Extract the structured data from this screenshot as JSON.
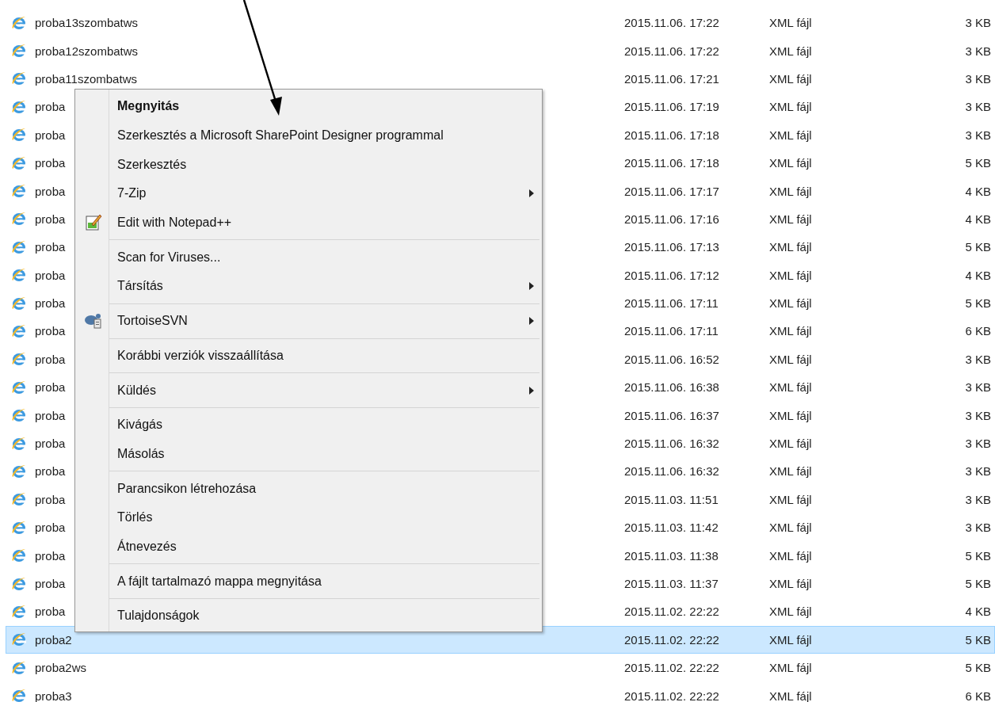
{
  "files": [
    {
      "name": "proba13szombatws",
      "date": "2015.11.06. 17:22",
      "type": "XML fájl",
      "size": "3 KB",
      "selected": false
    },
    {
      "name": "proba12szombatws",
      "date": "2015.11.06. 17:22",
      "type": "XML fájl",
      "size": "3 KB",
      "selected": false
    },
    {
      "name": "proba11szombatws",
      "date": "2015.11.06. 17:21",
      "type": "XML fájl",
      "size": "3 KB",
      "selected": false
    },
    {
      "name": "proba",
      "date": "2015.11.06. 17:19",
      "type": "XML fájl",
      "size": "3 KB",
      "selected": false
    },
    {
      "name": "proba",
      "date": "2015.11.06. 17:18",
      "type": "XML fájl",
      "size": "3 KB",
      "selected": false
    },
    {
      "name": "proba",
      "date": "2015.11.06. 17:18",
      "type": "XML fájl",
      "size": "5 KB",
      "selected": false
    },
    {
      "name": "proba",
      "date": "2015.11.06. 17:17",
      "type": "XML fájl",
      "size": "4 KB",
      "selected": false
    },
    {
      "name": "proba",
      "date": "2015.11.06. 17:16",
      "type": "XML fájl",
      "size": "4 KB",
      "selected": false
    },
    {
      "name": "proba",
      "date": "2015.11.06. 17:13",
      "type": "XML fájl",
      "size": "5 KB",
      "selected": false
    },
    {
      "name": "proba",
      "date": "2015.11.06. 17:12",
      "type": "XML fájl",
      "size": "4 KB",
      "selected": false
    },
    {
      "name": "proba",
      "date": "2015.11.06. 17:11",
      "type": "XML fájl",
      "size": "5 KB",
      "selected": false
    },
    {
      "name": "proba",
      "date": "2015.11.06. 17:11",
      "type": "XML fájl",
      "size": "6 KB",
      "selected": false
    },
    {
      "name": "proba",
      "date": "2015.11.06. 16:52",
      "type": "XML fájl",
      "size": "3 KB",
      "selected": false
    },
    {
      "name": "proba",
      "date": "2015.11.06. 16:38",
      "type": "XML fájl",
      "size": "3 KB",
      "selected": false
    },
    {
      "name": "proba",
      "date": "2015.11.06. 16:37",
      "type": "XML fájl",
      "size": "3 KB",
      "selected": false
    },
    {
      "name": "proba",
      "date": "2015.11.06. 16:32",
      "type": "XML fájl",
      "size": "3 KB",
      "selected": false
    },
    {
      "name": "proba",
      "date": "2015.11.06. 16:32",
      "type": "XML fájl",
      "size": "3 KB",
      "selected": false
    },
    {
      "name": "proba",
      "date": "2015.11.03. 11:51",
      "type": "XML fájl",
      "size": "3 KB",
      "selected": false
    },
    {
      "name": "proba",
      "date": "2015.11.03. 11:42",
      "type": "XML fájl",
      "size": "3 KB",
      "selected": false
    },
    {
      "name": "proba",
      "date": "2015.11.03. 11:38",
      "type": "XML fájl",
      "size": "5 KB",
      "selected": false
    },
    {
      "name": "proba",
      "date": "2015.11.03. 11:37",
      "type": "XML fájl",
      "size": "5 KB",
      "selected": false
    },
    {
      "name": "proba",
      "date": "2015.11.02. 22:22",
      "type": "XML fájl",
      "size": "4 KB",
      "selected": false
    },
    {
      "name": "proba2",
      "date": "2015.11.02. 22:22",
      "type": "XML fájl",
      "size": "5 KB",
      "selected": true
    },
    {
      "name": "proba2ws",
      "date": "2015.11.02. 22:22",
      "type": "XML fájl",
      "size": "5 KB",
      "selected": false
    },
    {
      "name": "proba3",
      "date": "2015.11.02. 22:22",
      "type": "XML fájl",
      "size": "6 KB",
      "selected": false
    }
  ],
  "context_menu": [
    {
      "kind": "item",
      "label": "Megnyitás",
      "default": true,
      "submenu": false
    },
    {
      "kind": "item",
      "label": "Szerkesztés a Microsoft SharePoint Designer programmal",
      "default": false,
      "submenu": false
    },
    {
      "kind": "item",
      "label": "Szerkesztés",
      "default": false,
      "submenu": false
    },
    {
      "kind": "item",
      "label": "7-Zip",
      "default": false,
      "submenu": true
    },
    {
      "kind": "icon_item",
      "label": "Edit with Notepad++",
      "default": false,
      "submenu": false
    },
    {
      "kind": "separator"
    },
    {
      "kind": "item",
      "label": "Scan for Viruses...",
      "default": false,
      "submenu": false
    },
    {
      "kind": "item",
      "label": "Társítás",
      "default": false,
      "submenu": true
    },
    {
      "kind": "separator"
    },
    {
      "kind": "icon_item",
      "label": "TortoiseSVN",
      "default": false,
      "submenu": true
    },
    {
      "kind": "separator"
    },
    {
      "kind": "item",
      "label": "Korábbi verziók visszaállítása",
      "default": false,
      "submenu": false
    },
    {
      "kind": "separator"
    },
    {
      "kind": "item",
      "label": "Küldés",
      "default": false,
      "submenu": true
    },
    {
      "kind": "separator"
    },
    {
      "kind": "item",
      "label": "Kivágás",
      "default": false,
      "submenu": false
    },
    {
      "kind": "item",
      "label": "Másolás",
      "default": false,
      "submenu": false
    },
    {
      "kind": "separator"
    },
    {
      "kind": "item",
      "label": "Parancsikon létrehozása",
      "default": false,
      "submenu": false
    },
    {
      "kind": "item",
      "label": "Törlés",
      "default": false,
      "submenu": false
    },
    {
      "kind": "item",
      "label": "Átnevezés",
      "default": false,
      "submenu": false
    },
    {
      "kind": "separator"
    },
    {
      "kind": "item",
      "label": "A fájlt tartalmazó mappa megnyitása",
      "default": false,
      "submenu": false
    },
    {
      "kind": "separator"
    },
    {
      "kind": "item",
      "label": "Tulajdonságok",
      "default": false,
      "submenu": false
    }
  ]
}
